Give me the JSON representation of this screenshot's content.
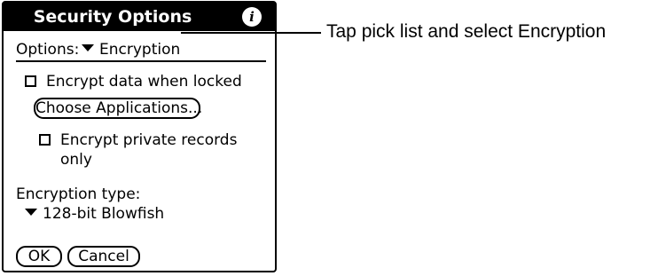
{
  "dialog": {
    "title": "Security Options",
    "info_icon": "info-icon",
    "options_label": "Options:",
    "options_value": "Encryption",
    "encrypt_locked_label": "Encrypt data when locked",
    "choose_apps_label": "Choose Applications...",
    "encrypt_private_line1": "Encrypt private records",
    "encrypt_private_line2": "only",
    "encryption_type_label": "Encryption type:",
    "encryption_type_value": "128-bit Blowfish",
    "ok_label": "OK",
    "cancel_label": "Cancel",
    "encrypt_locked_checked": false,
    "encrypt_private_checked": false
  },
  "callout": {
    "text": "Tap pick list and select Encryption"
  },
  "colors": {
    "titlebar": "#000000",
    "background": "#ffffff",
    "text": "#000000"
  }
}
